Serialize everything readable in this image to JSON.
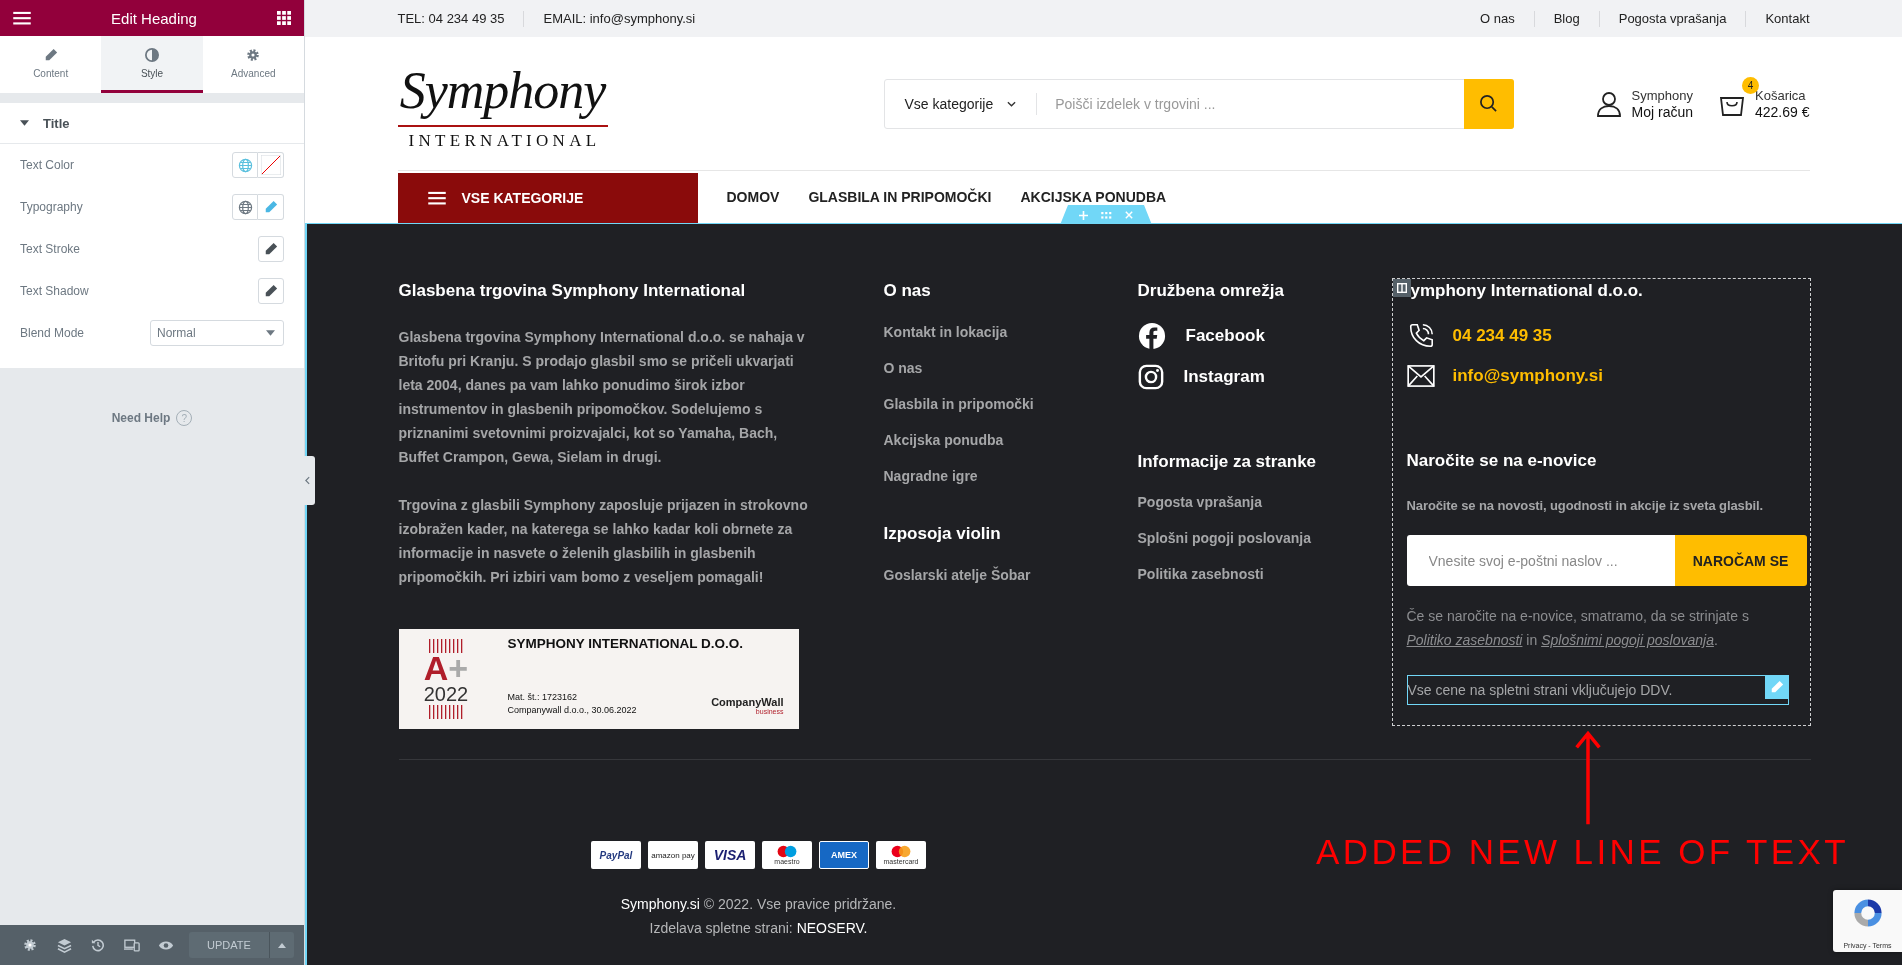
{
  "editor": {
    "title": "Edit Heading",
    "tabs": [
      {
        "label": "Content",
        "selected": false
      },
      {
        "label": "Style",
        "selected": true
      },
      {
        "label": "Advanced",
        "selected": false
      }
    ],
    "section": {
      "title": "Title",
      "expanded": true
    },
    "controls": [
      {
        "label": "Text Color",
        "kind": "color"
      },
      {
        "label": "Typography",
        "kind": "typography"
      },
      {
        "label": "Text Stroke",
        "kind": "edit"
      },
      {
        "label": "Text Shadow",
        "kind": "edit"
      },
      {
        "label": "Blend Mode",
        "kind": "select",
        "value": "Normal"
      }
    ],
    "help": {
      "label": "Need Help",
      "icon": "?"
    },
    "update": "UPDATE"
  },
  "topbar": {
    "contacts": [
      "TEL: 04 234 49 35",
      "EMAIL: info@symphony.si"
    ],
    "links": [
      "O nas",
      "Blog",
      "Pogosta vprašanja",
      "Kontakt"
    ]
  },
  "header": {
    "logo": {
      "script": "Symphony",
      "caption": "INTERNATIONAL"
    },
    "category_select": "Vse kategorije",
    "search_placeholder": "Poišči izdelek v trgovini ...",
    "account": {
      "name": "Symphony",
      "label": "Moj račun"
    },
    "cart": {
      "count": "4",
      "label": "Košarica",
      "total": "422.69 €"
    }
  },
  "nav": {
    "categories_button": "VSE KATEGORIJE",
    "items": [
      "DOMOV",
      "GLASBILA IN PRIPOMOČKI",
      "AKCIJSKA PONUDBA"
    ]
  },
  "footer": {
    "about": {
      "title": "Glasbena trgovina Symphony International",
      "paragraphs": [
        "Glasbena trgovina Symphony International d.o.o. se nahaja v Britofu pri Kranju. S prodajo glasbil smo se pričeli ukvarjati leta 2004, danes pa vam lahko ponudimo širok izbor instrumentov in glasbenih pripomočkov. Sodelujemo s priznanimi svetovnimi proizvajalci, kot so Yamaha, Bach, Buffet Crampon, Gewa, Sielam in drugi.",
        "Trgovina z glasbili Symphony zaposluje prijazen in strokovno izobražen kader, na katerega se lahko kadar koli obrnete za informacije in nasvete o želenih glasbilih in glasbenih pripomočkih. Pri izbiri vam bomo z veseljem pomagali!"
      ],
      "badge": {
        "grade": "A",
        "grade_sign": "+",
        "year": "2022",
        "company": "SYMPHONY INTERNATIONAL D.O.O.",
        "reg_label": "Mat. št.:",
        "reg_number": "1723162",
        "issued": "Companywall d.o.o., 30.06.2022",
        "brand": "CompanyWall",
        "brand_sub": "business"
      }
    },
    "menus": [
      {
        "title": "O nas",
        "links": [
          "Kontakt in lokacija",
          "O nas",
          "Glasbila in pripomočki",
          "Akcijska ponudba",
          "Nagradne igre"
        ]
      },
      {
        "title": "Izposoja violin",
        "links": [
          "Goslarski atelje Šobar"
        ]
      }
    ],
    "social": {
      "title": "Družbena omrežja",
      "items": [
        {
          "label": "Facebook",
          "kind": "facebook"
        },
        {
          "label": "Instagram",
          "kind": "instagram"
        }
      ]
    },
    "info": {
      "title": "Informacije za stranke",
      "links": [
        "Pogosta vprašanja",
        "Splošni pogoji poslovanja",
        "Politika zasebnosti"
      ]
    },
    "company": {
      "title": "ymphony International d.o.o.",
      "contacts": [
        {
          "kind": "phone",
          "text": "04 234 49 35"
        },
        {
          "kind": "email",
          "text": "info@symphony.si"
        }
      ],
      "newsletter_title": "Naročite se na e-novice",
      "newsletter_text": "Naročite se na novosti, ugodnosti in akcije iz sveta glasbil.",
      "email_placeholder": "Vnesite svoj e-poštni naslov ...",
      "subscribe": "NAROČAM SE",
      "consent": [
        {
          "text": "Če se naročite na e-novice, smatramo, da se strinjate s ",
          "link": false
        },
        {
          "text": "Politiko zasebnosti",
          "link": true
        },
        {
          "text": " in ",
          "link": false
        },
        {
          "text": "Splošnimi pogoji poslovanja",
          "link": true
        },
        {
          "text": ".",
          "link": false
        }
      ],
      "note": {
        "text": "Vse cene na spletni strani vključujejo DDV.",
        "selected": true
      }
    },
    "payments": [
      {
        "kind": "paypal",
        "label": "PayPal"
      },
      {
        "kind": "amazon",
        "label": "amazon pay"
      },
      {
        "kind": "visa",
        "label": "VISA"
      },
      {
        "kind": "maestro",
        "label": "maestro"
      },
      {
        "kind": "amex",
        "label": "AMEX"
      },
      {
        "kind": "mastercard",
        "label": "mastercard"
      }
    ],
    "copyright": {
      "site": "Symphony.si",
      "rest": " © 2022. Vse pravice pridržane."
    },
    "credit": {
      "label": "Izdelava spletne strani: ",
      "agency": "NEOSERV."
    }
  },
  "annotation": "ADDED NEW LINE OF TEXT",
  "recaptcha": "Privacy - Terms"
}
